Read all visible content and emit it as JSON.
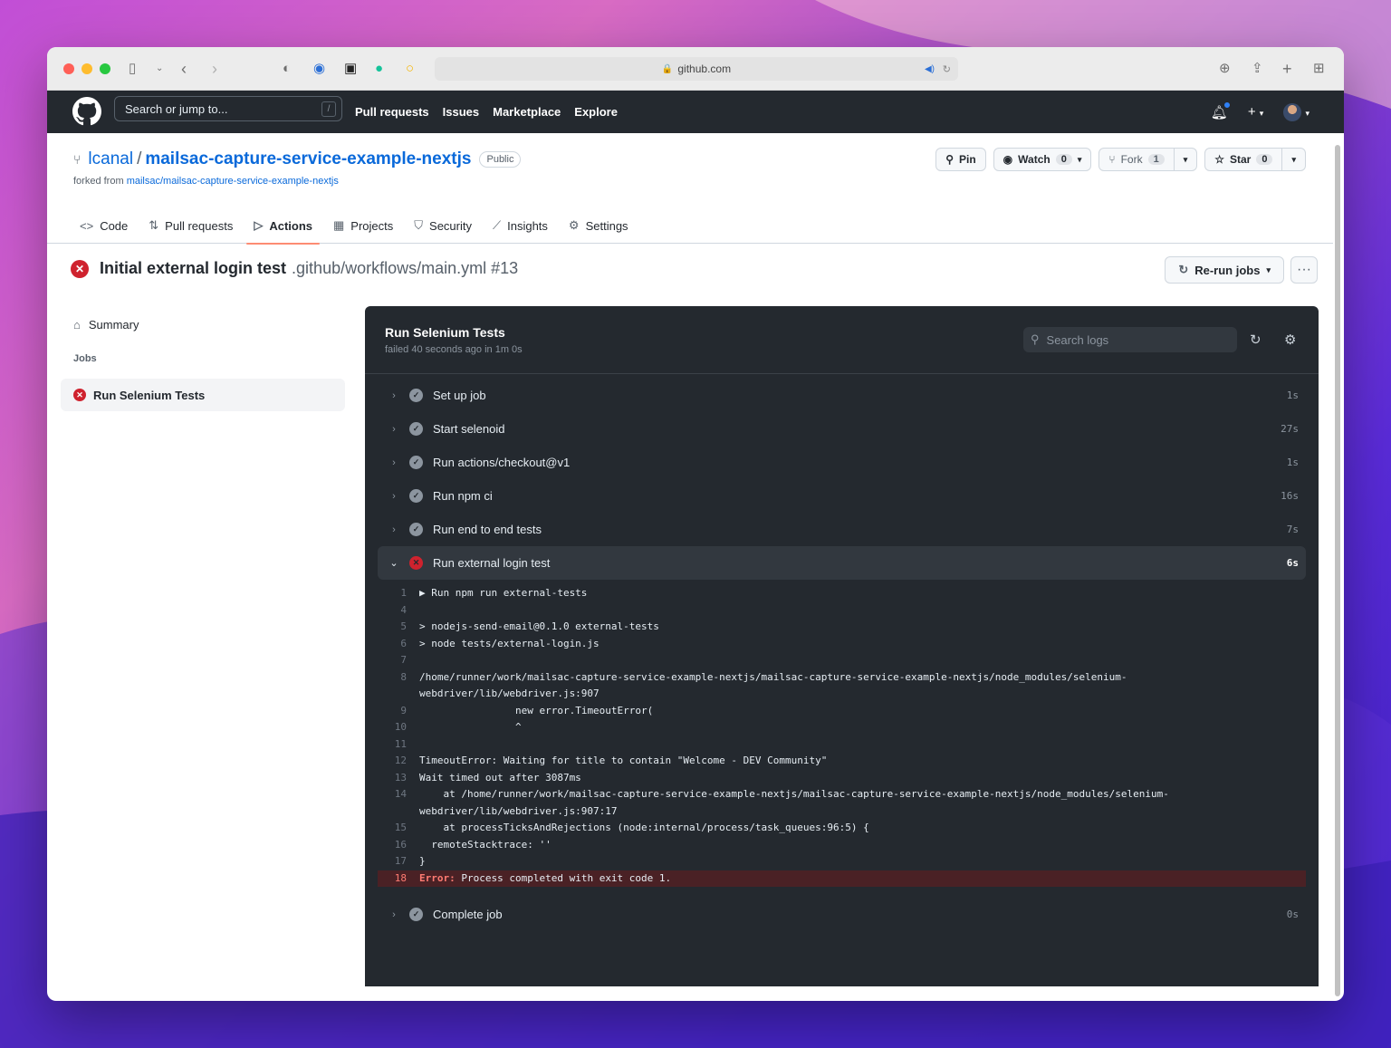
{
  "browser": {
    "url": "github.com",
    "traffic_colors": [
      "#ff5f57",
      "#febc2e",
      "#28c840"
    ]
  },
  "header": {
    "search_placeholder": "Search or jump to...",
    "slash": "/",
    "nav": [
      "Pull requests",
      "Issues",
      "Marketplace",
      "Explore"
    ]
  },
  "repo": {
    "owner": "lcanal",
    "name": "mailsac-capture-service-example-nextjs",
    "visibility": "Public",
    "forked_prefix": "forked from ",
    "forked_from": "mailsac/mailsac-capture-service-example-nextjs",
    "pin_label": "Pin",
    "watch_label": "Watch",
    "watch_count": "0",
    "fork_label": "Fork",
    "fork_count": "1",
    "star_label": "Star",
    "star_count": "0"
  },
  "tabs": [
    {
      "label": "Code",
      "icon": "code-icon"
    },
    {
      "label": "Pull requests",
      "icon": "pull-request-icon"
    },
    {
      "label": "Actions",
      "icon": "play-icon",
      "active": true
    },
    {
      "label": "Projects",
      "icon": "project-icon"
    },
    {
      "label": "Security",
      "icon": "shield-icon"
    },
    {
      "label": "Insights",
      "icon": "graph-icon"
    },
    {
      "label": "Settings",
      "icon": "gear-icon"
    }
  ],
  "workflow": {
    "title": "Initial external login test",
    "path": ".github/workflows/main.yml #13",
    "rerun_label": "Re-run jobs"
  },
  "sidebar": {
    "summary_label": "Summary",
    "jobs_heading": "Jobs",
    "job_label": "Run Selenium Tests"
  },
  "log": {
    "title": "Run Selenium Tests",
    "subtitle": "failed 40 seconds ago in 1m 0s",
    "search_placeholder": "Search logs",
    "steps": [
      {
        "label": "Set up job",
        "duration": "1s",
        "status": "success"
      },
      {
        "label": "Start selenoid",
        "duration": "27s",
        "status": "success"
      },
      {
        "label": "Run actions/checkout@v1",
        "duration": "1s",
        "status": "success"
      },
      {
        "label": "Run npm ci",
        "duration": "16s",
        "status": "success"
      },
      {
        "label": "Run end to end tests",
        "duration": "7s",
        "status": "success"
      },
      {
        "label": "Run external login test",
        "duration": "6s",
        "status": "failure",
        "open": true
      }
    ],
    "lines": [
      {
        "n": "1",
        "text": "▶ Run npm run external-tests"
      },
      {
        "n": "4",
        "text": ""
      },
      {
        "n": "5",
        "text": "> nodejs-send-email@0.1.0 external-tests"
      },
      {
        "n": "6",
        "text": "> node tests/external-login.js"
      },
      {
        "n": "7",
        "text": ""
      },
      {
        "n": "8",
        "text": "/home/runner/work/mailsac-capture-service-example-nextjs/mailsac-capture-service-example-nextjs/node_modules/selenium-\nwebdriver/lib/webdriver.js:907"
      },
      {
        "n": "9",
        "text": "                new error.TimeoutError("
      },
      {
        "n": "10",
        "text": "                ^"
      },
      {
        "n": "11",
        "text": ""
      },
      {
        "n": "12",
        "text": "TimeoutError: Waiting for title to contain \"Welcome - DEV Community\""
      },
      {
        "n": "13",
        "text": "Wait timed out after 3087ms"
      },
      {
        "n": "14",
        "text": "    at /home/runner/work/mailsac-capture-service-example-nextjs/mailsac-capture-service-example-nextjs/node_modules/selenium-\nwebdriver/lib/webdriver.js:907:17"
      },
      {
        "n": "15",
        "text": "    at processTicksAndRejections (node:internal/process/task_queues:96:5) {"
      },
      {
        "n": "16",
        "text": "  remoteStacktrace: ''"
      },
      {
        "n": "17",
        "text": "}"
      }
    ],
    "error_line": {
      "n": "18",
      "label": "Error:",
      "text": " Process completed with exit code 1."
    },
    "final_step": {
      "label": "Complete job",
      "duration": "0s",
      "status": "success"
    }
  }
}
